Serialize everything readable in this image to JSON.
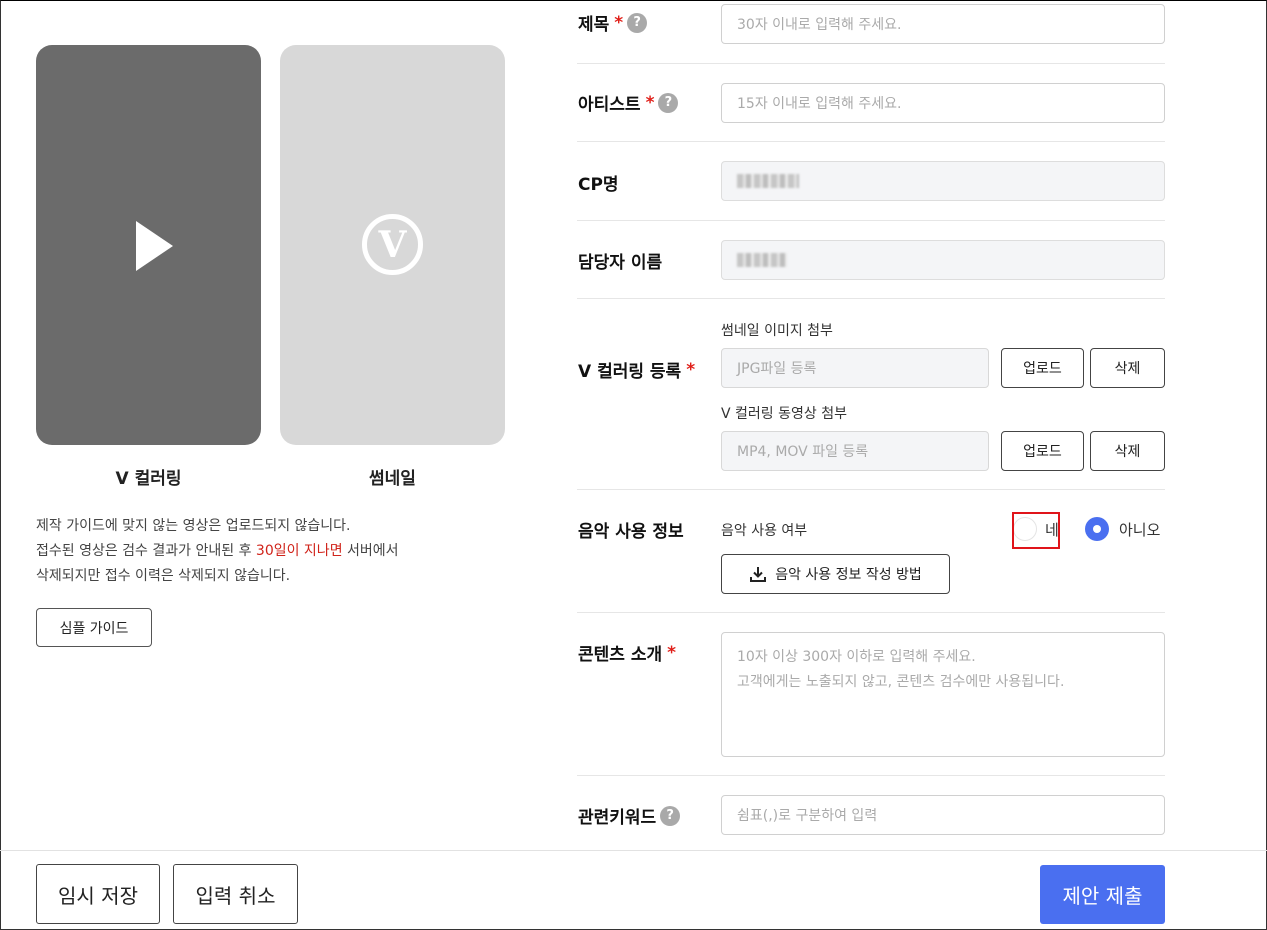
{
  "preview": {
    "video_caption": "V 컬러링",
    "thumb_caption": "썸네일",
    "logo_letter": "V",
    "notice_line1": "제작 가이드에 맞지 않는 영상은 업로드되지 않습니다.",
    "notice_line2_pre": "접수된 영상은 검수 결과가 안내된 후 ",
    "notice_line2_red": "30일이 지나면",
    "notice_line2_post": " 서버에서",
    "notice_line3": "삭제되지만 접수 이력은 삭제되지 않습니다.",
    "guide_button": "심플 가이드"
  },
  "form": {
    "required_mark": "*",
    "help_glyph": "?",
    "title": {
      "label": "제목",
      "placeholder": "30자 이내로 입력해 주세요."
    },
    "artist": {
      "label": "아티스트",
      "placeholder": "15자 이내로 입력해 주세요."
    },
    "cp_name": {
      "label": "CP명"
    },
    "manager_name": {
      "label": "담당자 이름"
    },
    "vcoloring": {
      "label": "V 컬러링 등록",
      "thumb_label": "썸네일 이미지 첨부",
      "thumb_placeholder": "JPG파일 등록",
      "video_label": "V 컬러링 동영상 첨부",
      "video_placeholder": "MP4, MOV 파일 등록",
      "upload_button": "업로드",
      "delete_button": "삭제"
    },
    "music": {
      "label": "음악 사용 정보",
      "question": "음악 사용 여부",
      "option_yes": "네",
      "option_no": "아니오",
      "selected": "아니오",
      "howto_button": "음악 사용 정보 작성 방법"
    },
    "intro": {
      "label": "콘텐츠 소개",
      "placeholder_line1": "10자 이상 300자 이하로 입력해 주세요.",
      "placeholder_line2": "고객에게는 노출되지 않고, 콘텐츠 검수에만 사용됩니다."
    },
    "keywords": {
      "label": "관련키워드",
      "placeholder": "쉼표(,)로 구분하여 입력"
    }
  },
  "footer": {
    "temp_save": "임시 저장",
    "cancel": "입력 취소",
    "submit": "제안 제출"
  },
  "colors": {
    "accent": "#4a6ff0",
    "required": "#e0201a",
    "highlight": "#e0141a",
    "notice_red": "#d0231a"
  }
}
